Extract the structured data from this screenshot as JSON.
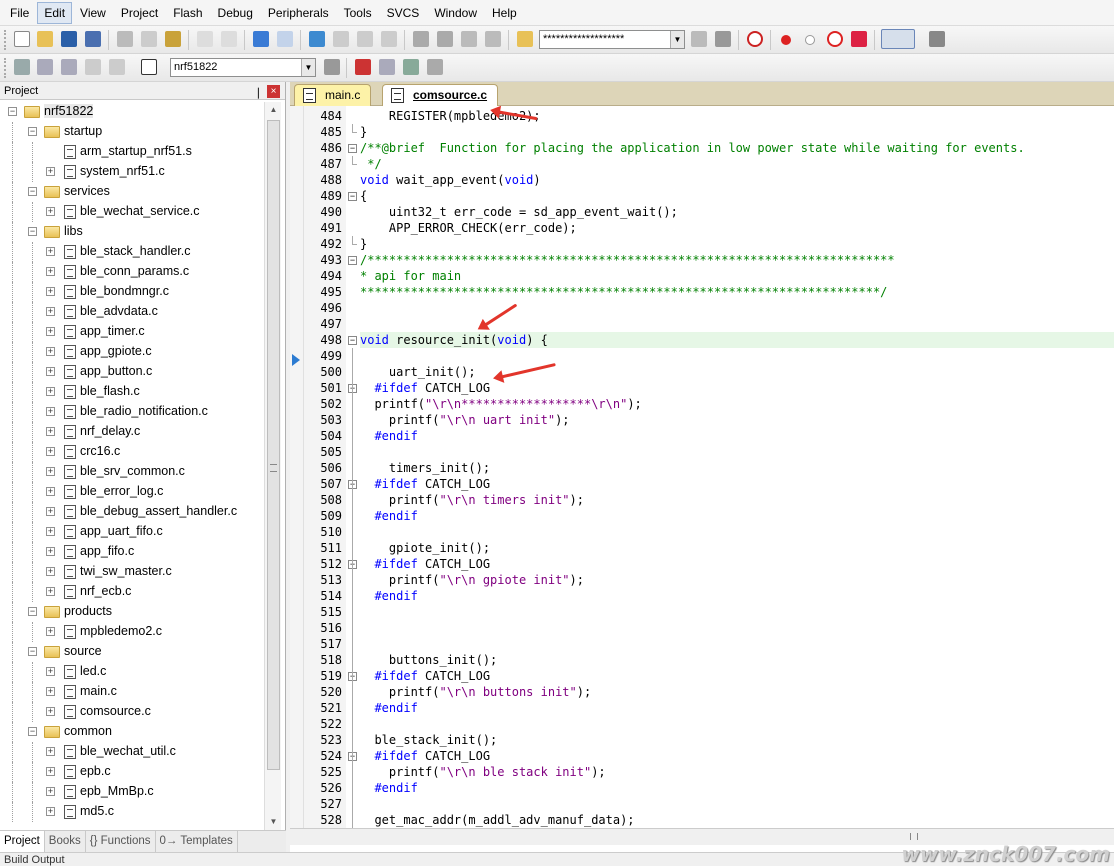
{
  "menu": [
    "File",
    "Edit",
    "View",
    "Project",
    "Flash",
    "Debug",
    "Peripherals",
    "Tools",
    "SVCS",
    "Window",
    "Help"
  ],
  "toolbar": {
    "find_combo": "*******************",
    "target_combo": "nrf51822"
  },
  "project_panel": {
    "title": "Project",
    "tree": [
      {
        "level": 0,
        "type": "root",
        "label": "nrf51822",
        "expander": "-"
      },
      {
        "level": 1,
        "type": "folder",
        "label": "startup",
        "expander": "-"
      },
      {
        "level": 2,
        "type": "file",
        "label": "arm_startup_nrf51.s",
        "expander": ""
      },
      {
        "level": 2,
        "type": "file",
        "label": "system_nrf51.c",
        "expander": "+"
      },
      {
        "level": 1,
        "type": "folder",
        "label": "services",
        "expander": "-"
      },
      {
        "level": 2,
        "type": "file",
        "label": "ble_wechat_service.c",
        "expander": "+"
      },
      {
        "level": 1,
        "type": "folder",
        "label": "libs",
        "expander": "-"
      },
      {
        "level": 2,
        "type": "file",
        "label": "ble_stack_handler.c",
        "expander": "+"
      },
      {
        "level": 2,
        "type": "file",
        "label": "ble_conn_params.c",
        "expander": "+"
      },
      {
        "level": 2,
        "type": "file",
        "label": "ble_bondmngr.c",
        "expander": "+"
      },
      {
        "level": 2,
        "type": "file",
        "label": "ble_advdata.c",
        "expander": "+"
      },
      {
        "level": 2,
        "type": "file",
        "label": "app_timer.c",
        "expander": "+"
      },
      {
        "level": 2,
        "type": "file",
        "label": "app_gpiote.c",
        "expander": "+"
      },
      {
        "level": 2,
        "type": "file",
        "label": "app_button.c",
        "expander": "+"
      },
      {
        "level": 2,
        "type": "file",
        "label": "ble_flash.c",
        "expander": "+"
      },
      {
        "level": 2,
        "type": "file",
        "label": "ble_radio_notification.c",
        "expander": "+"
      },
      {
        "level": 2,
        "type": "file",
        "label": "nrf_delay.c",
        "expander": "+"
      },
      {
        "level": 2,
        "type": "file",
        "label": "crc16.c",
        "expander": "+"
      },
      {
        "level": 2,
        "type": "file",
        "label": "ble_srv_common.c",
        "expander": "+"
      },
      {
        "level": 2,
        "type": "file",
        "label": "ble_error_log.c",
        "expander": "+"
      },
      {
        "level": 2,
        "type": "file",
        "label": "ble_debug_assert_handler.c",
        "expander": "+"
      },
      {
        "level": 2,
        "type": "file",
        "label": "app_uart_fifo.c",
        "expander": "+"
      },
      {
        "level": 2,
        "type": "file",
        "label": "app_fifo.c",
        "expander": "+"
      },
      {
        "level": 2,
        "type": "file",
        "label": "twi_sw_master.c",
        "expander": "+"
      },
      {
        "level": 2,
        "type": "file",
        "label": "nrf_ecb.c",
        "expander": "+"
      },
      {
        "level": 1,
        "type": "folder",
        "label": "products",
        "expander": "-"
      },
      {
        "level": 2,
        "type": "file",
        "label": "mpbledemo2.c",
        "expander": "+"
      },
      {
        "level": 1,
        "type": "folder",
        "label": "source",
        "expander": "-"
      },
      {
        "level": 2,
        "type": "file",
        "label": "led.c",
        "expander": "+"
      },
      {
        "level": 2,
        "type": "file",
        "label": "main.c",
        "expander": "+"
      },
      {
        "level": 2,
        "type": "file",
        "label": "comsource.c",
        "expander": "+"
      },
      {
        "level": 1,
        "type": "folder",
        "label": "common",
        "expander": "-"
      },
      {
        "level": 2,
        "type": "file",
        "label": "ble_wechat_util.c",
        "expander": "+"
      },
      {
        "level": 2,
        "type": "file",
        "label": "epb.c",
        "expander": "+"
      },
      {
        "level": 2,
        "type": "file",
        "label": "epb_MmBp.c",
        "expander": "+"
      },
      {
        "level": 2,
        "type": "file",
        "label": "md5.c",
        "expander": "+"
      }
    ],
    "tabs": [
      "Project",
      "Books",
      "{} Functions",
      "0→ Templates"
    ]
  },
  "editor": {
    "tabs": [
      "main.c",
      "comsource.c"
    ],
    "active_tab": "comsource.c",
    "lines": [
      {
        "n": "484",
        "fold": "",
        "code": "    REGISTER(mpbledemo2);"
      },
      {
        "n": "485",
        "fold": "end",
        "code": "}"
      },
      {
        "n": "486",
        "fold": "box",
        "code": "/**@brief  Function for placing the application in low power state while waiting for events."
      },
      {
        "n": "487",
        "fold": "end",
        "code": " */"
      },
      {
        "n": "488",
        "fold": "",
        "code": "void wait_app_event(void)"
      },
      {
        "n": "489",
        "fold": "box",
        "code": "{"
      },
      {
        "n": "490",
        "fold": "",
        "code": "    uint32_t err_code = sd_app_event_wait();"
      },
      {
        "n": "491",
        "fold": "",
        "code": "    APP_ERROR_CHECK(err_code);"
      },
      {
        "n": "492",
        "fold": "end",
        "code": "}"
      },
      {
        "n": "493",
        "fold": "box",
        "code": "/*************************************************************************"
      },
      {
        "n": "494",
        "fold": "",
        "code": "* api for main"
      },
      {
        "n": "495",
        "fold": "",
        "code": "************************************************************************/"
      },
      {
        "n": "496",
        "fold": "",
        "code": ""
      },
      {
        "n": "497",
        "fold": "",
        "code": ""
      },
      {
        "n": "498",
        "fold": "box",
        "code": "void resource_init(void) {"
      },
      {
        "n": "499",
        "fold": "",
        "code": ""
      },
      {
        "n": "500",
        "fold": "",
        "code": "    uart_init();"
      },
      {
        "n": "501",
        "fold": "box",
        "code": "  #ifdef CATCH_LOG"
      },
      {
        "n": "502",
        "fold": "",
        "code": "  printf(\"\\r\\n******************\\r\\n\");"
      },
      {
        "n": "503",
        "fold": "",
        "code": "    printf(\"\\r\\n uart init\");"
      },
      {
        "n": "504",
        "fold": "",
        "code": "  #endif"
      },
      {
        "n": "505",
        "fold": "",
        "code": ""
      },
      {
        "n": "506",
        "fold": "",
        "code": "    timers_init();"
      },
      {
        "n": "507",
        "fold": "box",
        "code": "  #ifdef CATCH_LOG"
      },
      {
        "n": "508",
        "fold": "",
        "code": "    printf(\"\\r\\n timers init\");"
      },
      {
        "n": "509",
        "fold": "",
        "code": "  #endif"
      },
      {
        "n": "510",
        "fold": "",
        "code": ""
      },
      {
        "n": "511",
        "fold": "",
        "code": "    gpiote_init();"
      },
      {
        "n": "512",
        "fold": "box",
        "code": "  #ifdef CATCH_LOG"
      },
      {
        "n": "513",
        "fold": "",
        "code": "    printf(\"\\r\\n gpiote init\");"
      },
      {
        "n": "514",
        "fold": "",
        "code": "  #endif"
      },
      {
        "n": "515",
        "fold": "",
        "code": ""
      },
      {
        "n": "516",
        "fold": "",
        "code": ""
      },
      {
        "n": "517",
        "fold": "",
        "code": ""
      },
      {
        "n": "518",
        "fold": "",
        "code": "    buttons_init();"
      },
      {
        "n": "519",
        "fold": "box",
        "code": "  #ifdef CATCH_LOG"
      },
      {
        "n": "520",
        "fold": "",
        "code": "    printf(\"\\r\\n buttons init\");"
      },
      {
        "n": "521",
        "fold": "",
        "code": "  #endif"
      },
      {
        "n": "522",
        "fold": "",
        "code": ""
      },
      {
        "n": "523",
        "fold": "",
        "code": "  ble_stack_init();"
      },
      {
        "n": "524",
        "fold": "box",
        "code": "  #ifdef CATCH_LOG"
      },
      {
        "n": "525",
        "fold": "",
        "code": "    printf(\"\\r\\n ble stack init\");"
      },
      {
        "n": "526",
        "fold": "",
        "code": "  #endif"
      },
      {
        "n": "527",
        "fold": "",
        "code": ""
      },
      {
        "n": "528",
        "fold": "",
        "code": "  get_mac_addr(m_addl_adv_manuf_data);"
      }
    ],
    "highlight_line": "498"
  },
  "status": {
    "bottom_label": "Build Output",
    "watermark": "www.znck007.com"
  }
}
